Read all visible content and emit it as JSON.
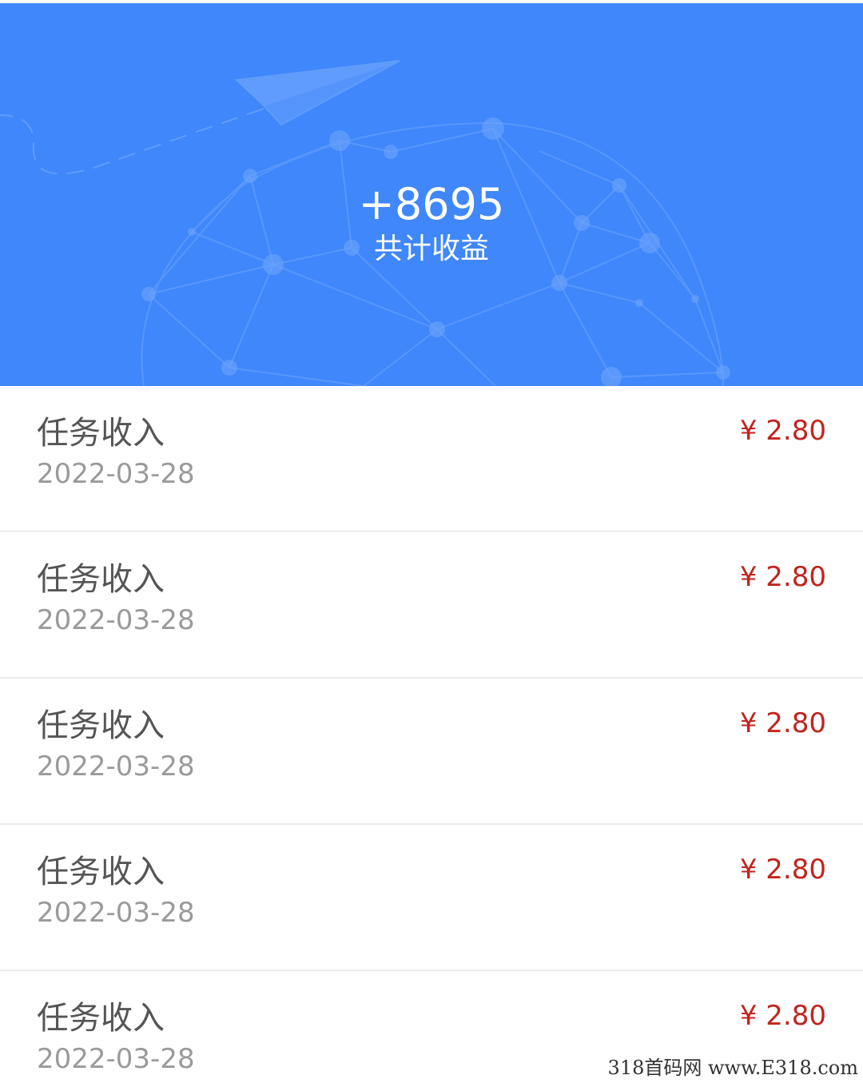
{
  "header": {
    "total_amount": "+8695",
    "total_label": "共计收益",
    "background_color": "#3f87fb",
    "decoration_icons": [
      "paper-plane-icon",
      "network-globe-icon"
    ]
  },
  "transactions": [
    {
      "title": "任务收入",
      "date": "2022-03-28",
      "amount": "¥ 2.80"
    },
    {
      "title": "任务收入",
      "date": "2022-03-28",
      "amount": "¥ 2.80"
    },
    {
      "title": "任务收入",
      "date": "2022-03-28",
      "amount": "¥ 2.80"
    },
    {
      "title": "任务收入",
      "date": "2022-03-28",
      "amount": "¥ 2.80"
    },
    {
      "title": "任务收入",
      "date": "2022-03-28",
      "amount": "¥ 2.80"
    }
  ],
  "colors": {
    "amount": "#c0241e",
    "title": "#555555",
    "date": "#9a9a9a"
  },
  "watermark": {
    "text": "318首码网  www.E318.com"
  }
}
